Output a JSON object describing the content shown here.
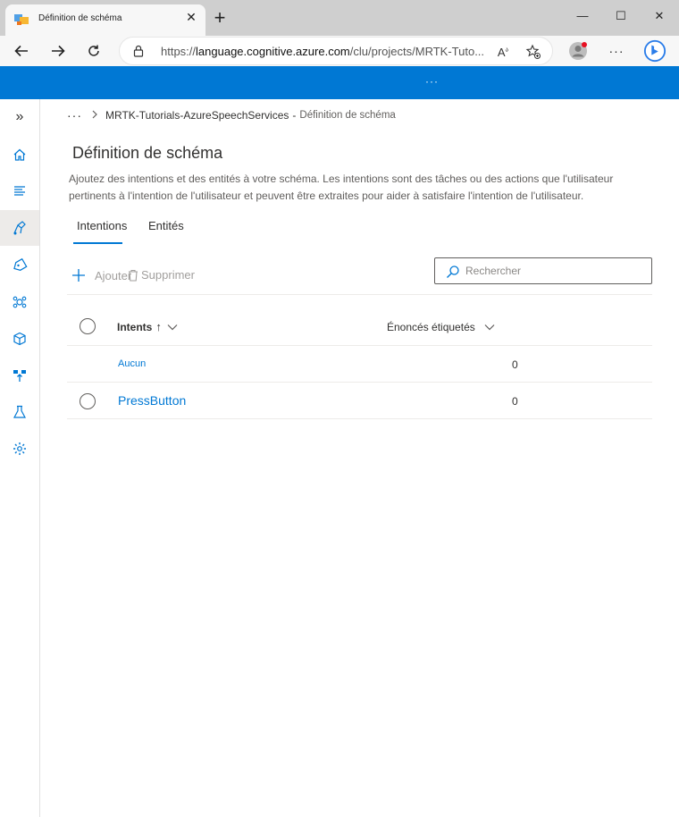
{
  "browser": {
    "tab_title": "Définition de schéma",
    "url_prefix": "https://",
    "url_domain": "language.cognitive.azure.com",
    "url_path": "/clu/projects/MRTK-Tuto...",
    "blue_bar_dots": "···",
    "colors": {
      "blue_bar": "#0078d4",
      "profile_badge": "#e81123"
    }
  },
  "rail": {
    "items": [
      "expand-icon",
      "home-icon",
      "schema-list-icon",
      "build-icon",
      "tag-icon",
      "train-icon",
      "deploy-box-icon",
      "upload-icon",
      "test-flask-icon",
      "settings-gear-icon"
    ],
    "active_index": 2
  },
  "breadcrumb": {
    "more": "···",
    "project": "MRTK-Tutorials-AzureSpeechServices",
    "separator": "-",
    "current": "Définition de schéma"
  },
  "page": {
    "title": "Définition de schéma",
    "description_line1": "Ajoutez des intentions et des entités à votre schéma. Les intentions sont des tâches ou des actions que l'utilisateur",
    "description_line2": "pertinents à l'intention de l'utilisateur et peuvent être extraites pour aider à satisfaire l'intention de l'utilisateur."
  },
  "tabs": [
    {
      "label": "Intentions",
      "active": true
    },
    {
      "label": "Entités",
      "active": false
    }
  ],
  "commands": {
    "add_label": "Ajouter",
    "delete_label": "Supprimer"
  },
  "search": {
    "placeholder": "Rechercher"
  },
  "grid": {
    "columns": {
      "intents": "Intents",
      "sort_arrow": "↑",
      "enonces": "Énoncés étiquetés"
    },
    "rows": [
      {
        "name": "Aucun",
        "count": "0"
      },
      {
        "name": "PressButton",
        "count": "0"
      }
    ]
  }
}
